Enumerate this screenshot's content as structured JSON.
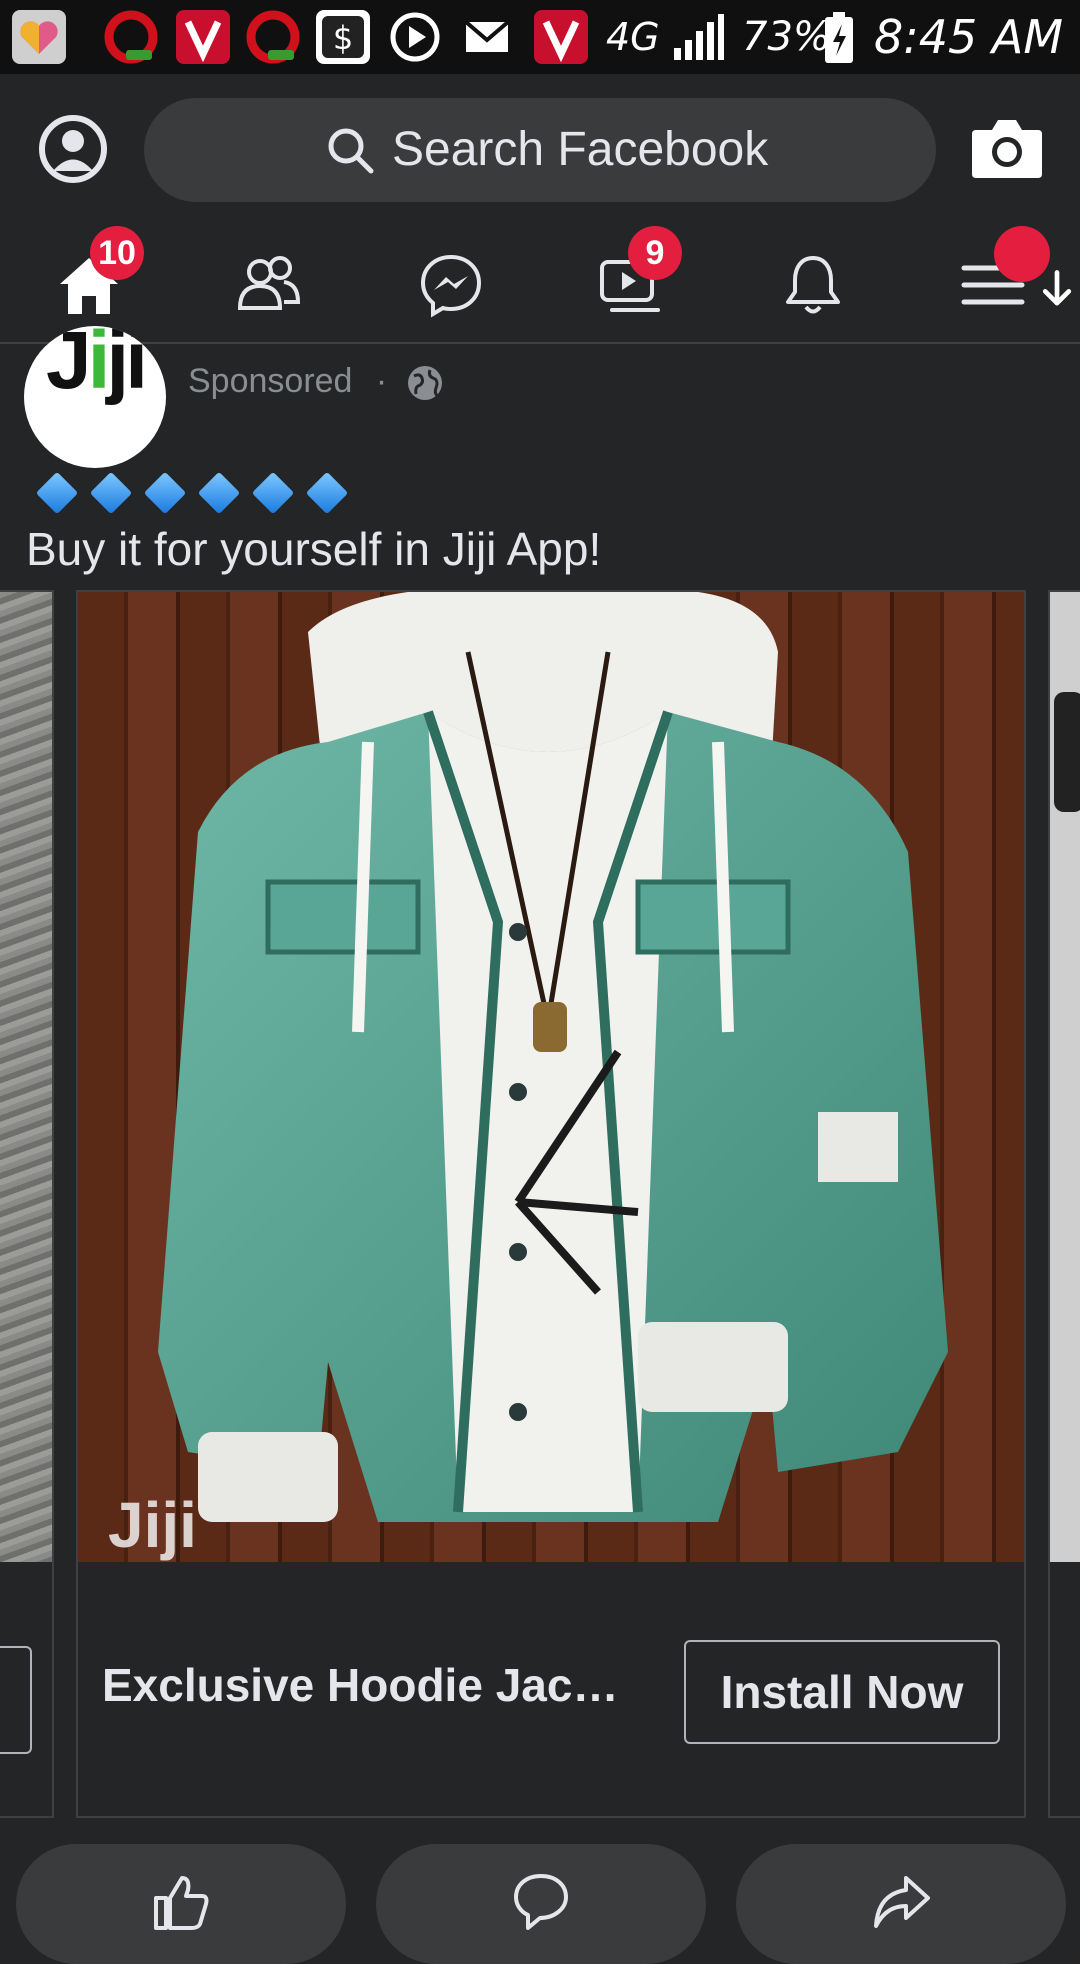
{
  "status_bar": {
    "network": "4G",
    "battery": "73%",
    "time": "8:45 AM",
    "notification_icons": [
      "photos-icon",
      "opera-mini-icon",
      "v-app-icon",
      "opera-mini-icon",
      "dollar-app-icon",
      "play-icon",
      "mail-icon",
      "v-app-icon"
    ]
  },
  "header": {
    "search_placeholder": "Search Facebook",
    "nav": {
      "home_badge": "10",
      "watch_badge": "9"
    }
  },
  "post": {
    "author_logo_text": "Jiji",
    "sponsored": "Sponsored",
    "separator": "·",
    "diamonds": [
      "🔷",
      "🔷",
      "🔷",
      "🔷",
      "🔷",
      "🔷"
    ],
    "caption": "Buy it for yourself in Jiji App!",
    "card": {
      "title": "Exclusive Hoodie Jack...",
      "cta": "Install Now",
      "watermark": "Jiji"
    }
  },
  "colors": {
    "background": "#242526",
    "search_bg": "#3a3b3c",
    "badge": "#e41e3f",
    "text": "#e4e6eb",
    "muted": "#8a8d91"
  }
}
